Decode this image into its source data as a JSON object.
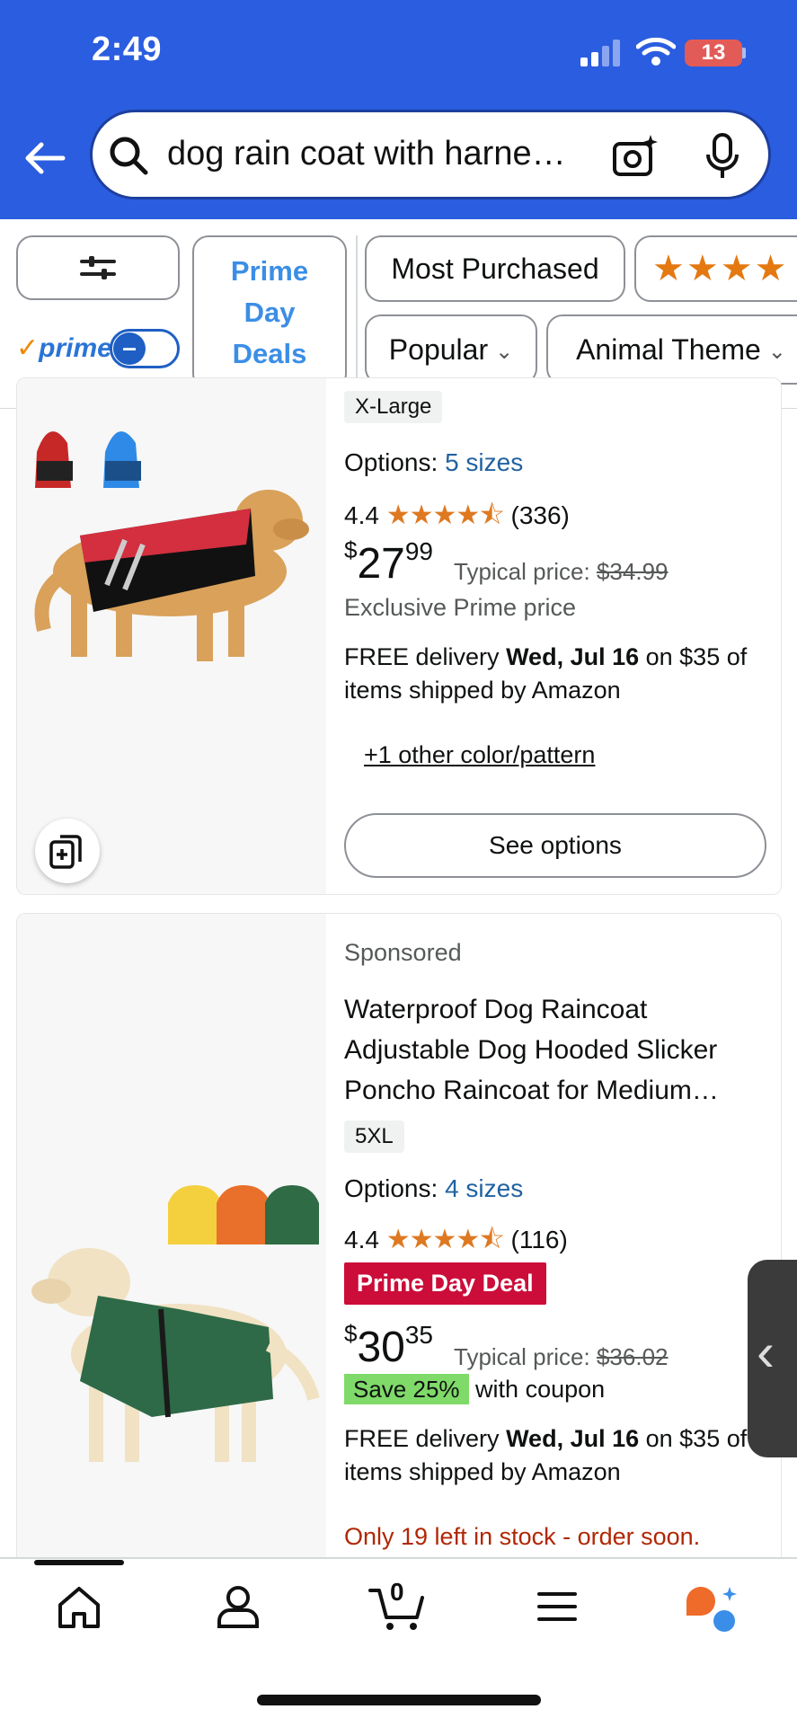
{
  "status_bar": {
    "time": "2:49",
    "battery": "13"
  },
  "search": {
    "query": "dog rain coat with harne…"
  },
  "filters": {
    "prime_label": "prime",
    "prime_check": "✓",
    "prime_day_deals": [
      "Prime",
      "Day",
      "Deals"
    ],
    "most_purchased": "Most Purchased",
    "stars": "★★★★",
    "popular": "Popular",
    "animal_theme": "Animal Theme"
  },
  "product1": {
    "size_badge": "X-Large",
    "options_label": "Options:",
    "options_link": "5 sizes",
    "rating": "4.4",
    "stars": "★★★★⯪",
    "reviews": "(336)",
    "price_symbol": "$",
    "price_whole": "27",
    "price_cents": "99",
    "typical_label": "Typical price:",
    "typical_price": "$34.99",
    "exclusive": "Exclusive Prime price",
    "delivery_prefix": "FREE delivery ",
    "delivery_date": "Wed, Jul 16",
    "delivery_suffix": " on $35 of",
    "delivery_line2": "items shipped by Amazon",
    "other_color": "+1 other color/pattern",
    "see_options": "See options"
  },
  "product2": {
    "sponsored": "Sponsored",
    "title_lines": [
      "Waterproof Dog Raincoat",
      "Adjustable Dog Hooded Slicker",
      "Poncho Raincoat for Medium…"
    ],
    "size_badge": "5XL",
    "options_label": "Options:",
    "options_link": "4 sizes",
    "rating": "4.4",
    "stars": "★★★★⯪",
    "reviews": "(116)",
    "deal_badge": "Prime Day Deal",
    "price_symbol": "$",
    "price_whole": "30",
    "price_cents": "35",
    "typical_label": "Typical price:",
    "typical_price": "$36.02",
    "save_badge": "Save 25%",
    "coupon_text": "with coupon",
    "delivery_prefix": "FREE delivery ",
    "delivery_date": "Wed, Jul 16",
    "delivery_suffix": " on $35 of",
    "delivery_line2": "items shipped by Amazon",
    "stock": "Only 19 left in stock - order soon."
  },
  "bottom_nav": {
    "cart_count": "0"
  },
  "colors": {
    "header_blue": "#2b5de0",
    "accent_orange": "#de7921",
    "deal_red": "#cc0c39",
    "link_blue": "#2162a1",
    "save_green": "#7fda69"
  }
}
